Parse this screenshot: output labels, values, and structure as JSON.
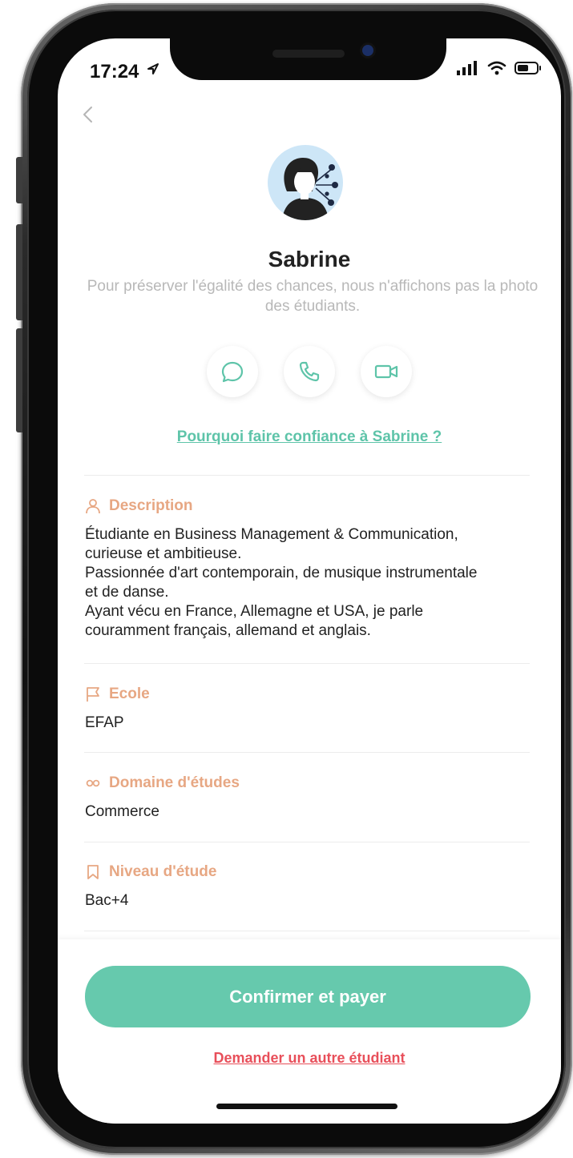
{
  "status_bar": {
    "time": "17:24"
  },
  "profile": {
    "name": "Sabrine",
    "subtitle": "Pour préserver l'égalité des chances, nous n'affichons pas la photo des étudiants."
  },
  "trust_link": "Pourquoi faire confiance à Sabrine ?",
  "sections": {
    "description": {
      "title": "Description",
      "lines": [
        "Étudiante en Business Management & Communication,",
        "curieuse et ambitieuse.",
        "Passionnée d'art contemporain, de musique instrumentale",
        "et de danse.",
        "Ayant vécu en France, Allemagne et USA, je parle",
        "couramment français, allemand et anglais."
      ]
    },
    "school": {
      "title": "Ecole",
      "value": "EFAP"
    },
    "field": {
      "title": "Domaine d'études",
      "value": "Commerce"
    },
    "level": {
      "title": "Niveau d'étude",
      "value": "Bac+4"
    }
  },
  "cta": {
    "confirm_label": "Confirmer et payer",
    "other_label": "Demander un autre étudiant"
  },
  "colors": {
    "accent_green": "#66c9ad",
    "link_green": "#5ec4a9",
    "section_orange": "#e7a783",
    "danger_red": "#e84f5a",
    "avatar_bg": "#cde6f7"
  }
}
